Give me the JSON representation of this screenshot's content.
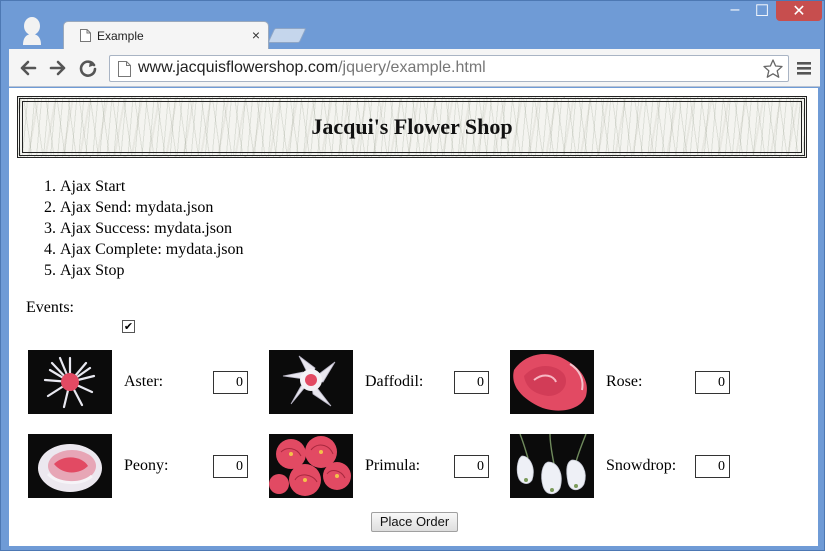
{
  "browser": {
    "tab_title": "Example",
    "tab_close": "×",
    "url_host": "www.jacquisflowershop.com",
    "url_path": "/jquery/example.html",
    "window_controls": {
      "minimize": "–",
      "maximize": "☐",
      "close": "✕"
    }
  },
  "page": {
    "shop_name": "Jacqui's Flower Shop",
    "events_log": [
      "Ajax Start",
      "Ajax Send: mydata.json",
      "Ajax Success: mydata.json",
      "Ajax Complete: mydata.json",
      "Ajax Stop"
    ],
    "events_label": "Events:",
    "events_checkbox_checked": true,
    "events_checkbox_mark": "✔",
    "products": [
      {
        "name": "Aster:",
        "qty": "0",
        "image": "aster-flower"
      },
      {
        "name": "Daffodil:",
        "qty": "0",
        "image": "daffodil-flower"
      },
      {
        "name": "Rose:",
        "qty": "0",
        "image": "rose-flower"
      },
      {
        "name": "Peony:",
        "qty": "0",
        "image": "peony-flower"
      },
      {
        "name": "Primula:",
        "qty": "0",
        "image": "primula-flower"
      },
      {
        "name": "Snowdrop:",
        "qty": "0",
        "image": "snowdrop-flower"
      }
    ],
    "place_order_label": "Place Order"
  },
  "colors": {
    "chrome_blue": "#6f9bd6",
    "flower_pink": "#e24a63",
    "image_background": "#0b0b0b"
  }
}
